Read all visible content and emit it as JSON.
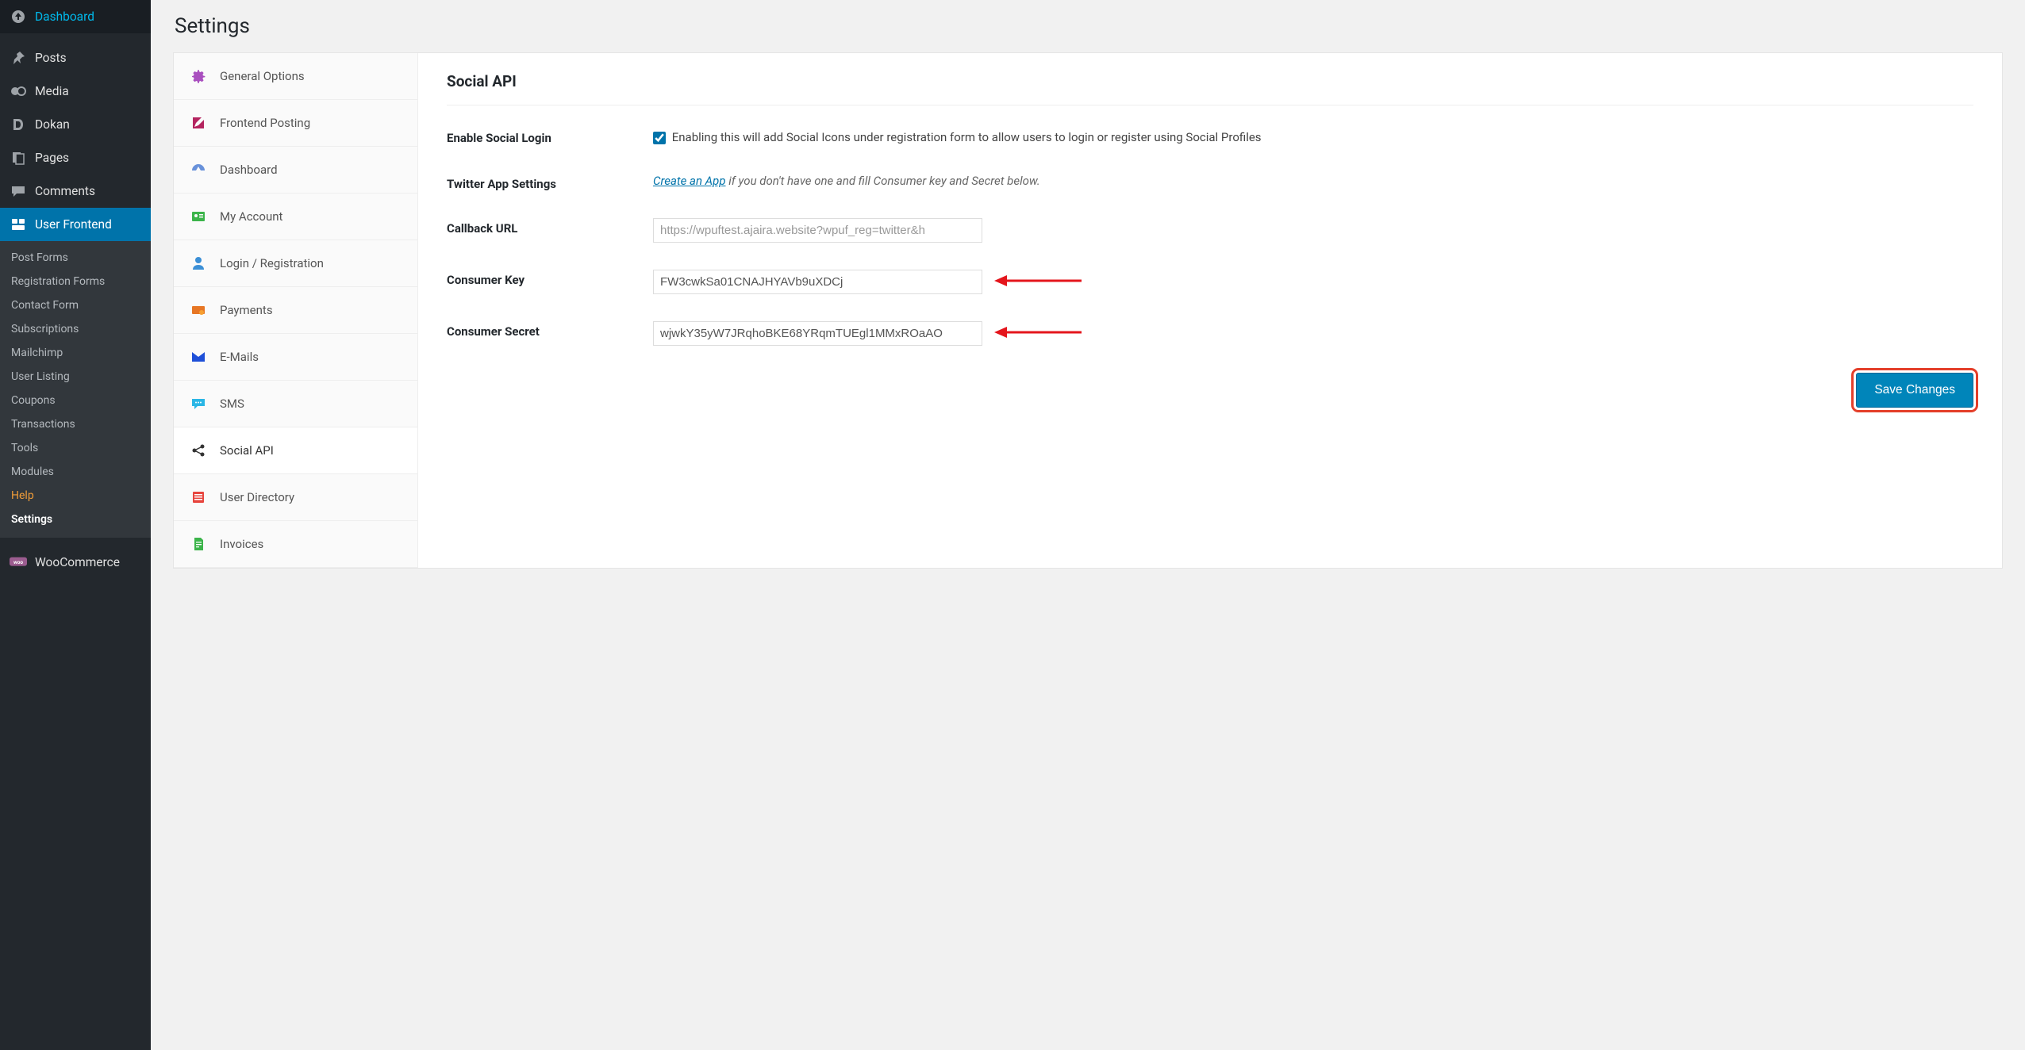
{
  "wp_menu": {
    "dashboard": "Dashboard",
    "posts": "Posts",
    "media": "Media",
    "dokan": "Dokan",
    "pages": "Pages",
    "comments": "Comments",
    "user_frontend": "User Frontend",
    "woocommerce": "WooCommerce"
  },
  "uf_submenu": {
    "post_forms": "Post Forms",
    "registration_forms": "Registration Forms",
    "contact_form": "Contact Form",
    "subscriptions": "Subscriptions",
    "mailchimp": "Mailchimp",
    "user_listing": "User Listing",
    "coupons": "Coupons",
    "transactions": "Transactions",
    "tools": "Tools",
    "modules": "Modules",
    "help": "Help",
    "settings": "Settings"
  },
  "page": {
    "title": "Settings"
  },
  "tabs": {
    "general": "General Options",
    "frontend_posting": "Frontend Posting",
    "dashboard": "Dashboard",
    "my_account": "My Account",
    "login_reg": "Login / Registration",
    "payments": "Payments",
    "emails": "E-Mails",
    "sms": "SMS",
    "social_api": "Social API",
    "user_directory": "User Directory",
    "invoices": "Invoices"
  },
  "panel": {
    "heading": "Social API",
    "enable_label": "Enable Social Login",
    "enable_desc": "Enabling this will add Social Icons under registration form to allow users to login or register using Social Profiles",
    "enable_checked": true,
    "twitter_label": "Twitter App Settings",
    "twitter_link_text": "Create an App",
    "twitter_hint": " if you don't have one and fill Consumer key and Secret below.",
    "callback_label": "Callback URL",
    "callback_value": "https://wpuftest.ajaira.website?wpuf_reg=twitter&h",
    "ckey_label": "Consumer Key",
    "ckey_value": "FW3cwkSa01CNAJHYAVb9uXDCj",
    "csecret_label": "Consumer Secret",
    "csecret_value": "wjwkY35yW7JRqhoBKE68YRqmTUEgl1MMxROaAO",
    "save_label": "Save Changes"
  }
}
